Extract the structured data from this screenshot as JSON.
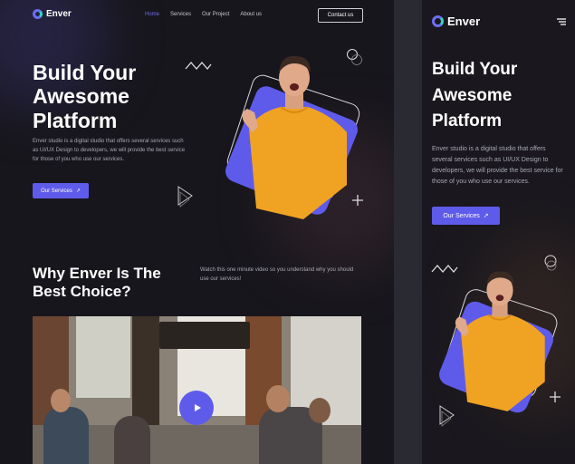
{
  "desktop": {
    "logo": "Enver",
    "nav": [
      "Home",
      "Services",
      "Our Project",
      "About us"
    ],
    "contact_label": "Contact us",
    "hero": {
      "title_lines": [
        "Build Your",
        "Awesome",
        "Platform"
      ],
      "description": "Enver studio is a digital studio that offers several services such as UI/UX Design to developers, we will provide the best service for those of you who use our services.",
      "cta": "Our Services"
    },
    "why": {
      "title_lines": [
        "Why Enver Is The",
        "Best Choice?"
      ],
      "description": "Watch this one minute video so you understand why you should use our services!"
    }
  },
  "mobile": {
    "logo": "Enver",
    "hero": {
      "title_lines": [
        "Build Your",
        "Awesome",
        "Platform"
      ],
      "description": "Enver studio is a digital studio that offers several services such as UI/UX Design to developers, we will provide the best service for those of you who use our services.",
      "cta": "Our Services"
    }
  },
  "colors": {
    "accent": "#5f5bea",
    "background": "#17161c",
    "sweater": "#f0a322"
  }
}
